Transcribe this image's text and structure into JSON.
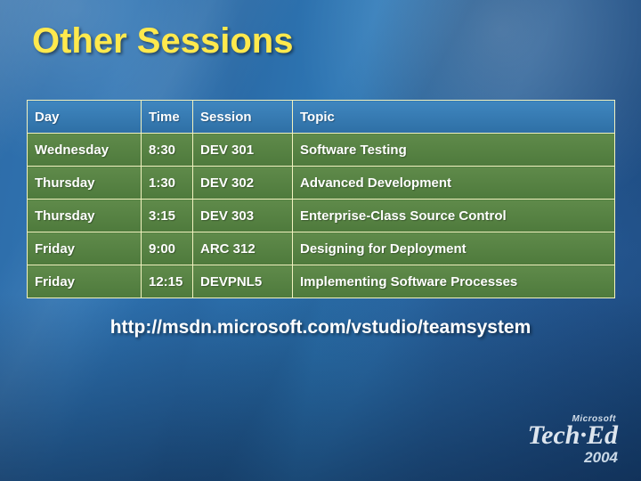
{
  "slide": {
    "title": "Other Sessions",
    "url": "http://msdn.microsoft.com/vstudio/teamsystem"
  },
  "table": {
    "headers": [
      "Day",
      "Time",
      "Session",
      "Topic"
    ],
    "rows": [
      [
        "Wednesday",
        "8:30",
        "DEV 301",
        "Software Testing"
      ],
      [
        "Thursday",
        "1:30",
        "DEV 302",
        "Advanced Development"
      ],
      [
        "Thursday",
        "3:15",
        "DEV 303",
        "Enterprise-Class Source Control"
      ],
      [
        "Friday",
        "9:00",
        "ARC 312",
        "Designing for Deployment"
      ],
      [
        "Friday",
        "12:15",
        "DEVPNL5",
        "Implementing Software Processes"
      ]
    ]
  },
  "logo": {
    "brand": "Microsoft",
    "event": "Tech·Ed",
    "year": "2004"
  },
  "colors": {
    "title": "#ffe94d",
    "header_row": "#2e6fa5",
    "body_row": "#4e7a3c",
    "border": "#f2f2c0",
    "background": "#2a6aa6"
  }
}
